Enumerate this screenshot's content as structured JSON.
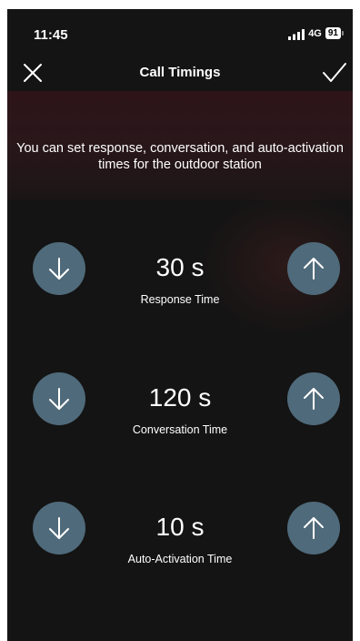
{
  "status_bar": {
    "time": "11:45",
    "network": "4G",
    "battery": "91",
    "signal_icon": "cellular-signal-icon"
  },
  "navbar": {
    "title": "Call Timings",
    "close_icon": "close-icon",
    "confirm_icon": "checkmark-icon"
  },
  "description": "You can set response, conversation, and auto-activation times for the outdoor station",
  "timings": [
    {
      "value": "30 s",
      "label": "Response Time"
    },
    {
      "value": "120 s",
      "label": "Conversation Time"
    },
    {
      "value": "10 s",
      "label": "Auto-Activation Time"
    }
  ],
  "colors": {
    "background": "#141414",
    "stepper_button": "#4f6a7a",
    "text": "#ffffff"
  }
}
